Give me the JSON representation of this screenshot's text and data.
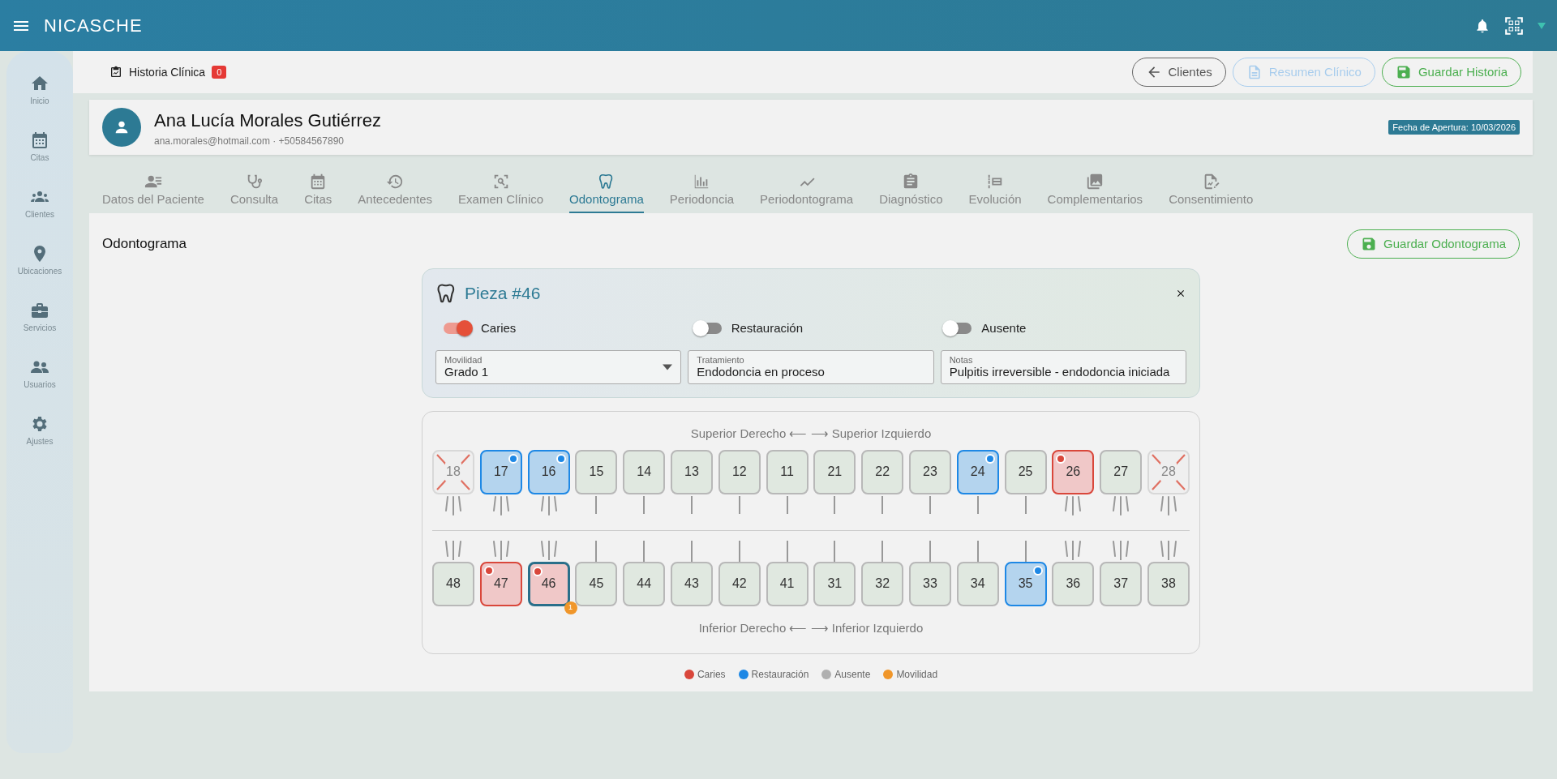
{
  "app_bar": {
    "title": "NICASCHE"
  },
  "sidebar": {
    "items": [
      {
        "label": "Inicio"
      },
      {
        "label": "Citas"
      },
      {
        "label": "Clientes"
      },
      {
        "label": "Ubicaciones"
      },
      {
        "label": "Servicios"
      },
      {
        "label": "Usuarios"
      },
      {
        "label": "Ajustes"
      }
    ]
  },
  "toolbar": {
    "title": "Historia Clínica",
    "badge": "0",
    "buttons": [
      {
        "label": "Clientes",
        "kind": "back",
        "disabled": false
      },
      {
        "label": "Resumen Clínico",
        "kind": "document",
        "disabled": true
      },
      {
        "label": "Guardar Historia",
        "kind": "save",
        "disabled": false
      }
    ]
  },
  "patient": {
    "name": "Ana Lucía Morales Gutiérrez",
    "contact": "ana.morales@hotmail.com · +50584567890",
    "opening_date": "Fecha de Apertura: 10/03/2026"
  },
  "tabs": [
    {
      "label": "Datos del Paciente",
      "selected": false
    },
    {
      "label": "Consulta",
      "selected": false
    },
    {
      "label": "Citas",
      "selected": false
    },
    {
      "label": "Antecedentes",
      "selected": false
    },
    {
      "label": "Examen Clínico",
      "selected": false
    },
    {
      "label": "Odontograma",
      "selected": true
    },
    {
      "label": "Periodoncia",
      "selected": false
    },
    {
      "label": "Periodontograma",
      "selected": false
    },
    {
      "label": "Diagnóstico",
      "selected": false
    },
    {
      "label": "Evolución",
      "selected": false
    },
    {
      "label": "Complementarios",
      "selected": false
    },
    {
      "label": "Consentimiento",
      "selected": false
    }
  ],
  "section": {
    "title": "Odontograma",
    "save_button": "Guardar Odontograma"
  },
  "piece_editor": {
    "title": "Pieza #46",
    "toggles": [
      {
        "label": "Caries",
        "on": true
      },
      {
        "label": "Restauración",
        "on": false
      },
      {
        "label": "Ausente",
        "on": false
      }
    ],
    "fields": [
      {
        "label": "Movilidad",
        "value": "Grado 1",
        "kind": "select"
      },
      {
        "label": "Tratamiento",
        "value": "Endodoncia en proceso",
        "kind": "text"
      },
      {
        "label": "Notas",
        "value": "Pulpitis irreversible - endodoncia iniciada",
        "kind": "text"
      }
    ]
  },
  "chart": {
    "upper_caption": "Superior Derecho ⟵ ⟶ Superior Izquierdo",
    "upper": [
      {
        "number": "18",
        "caries": false,
        "restoration": false,
        "absent": true,
        "kind": "molar",
        "selected": false
      },
      {
        "number": "17",
        "caries": false,
        "restoration": true,
        "absent": false,
        "kind": "molar",
        "selected": false
      },
      {
        "number": "16",
        "caries": false,
        "restoration": true,
        "absent": false,
        "kind": "molar",
        "selected": false
      },
      {
        "number": "15",
        "caries": false,
        "restoration": false,
        "absent": false,
        "kind": "single",
        "selected": false
      },
      {
        "number": "14",
        "caries": false,
        "restoration": false,
        "absent": false,
        "kind": "single",
        "selected": false
      },
      {
        "number": "13",
        "caries": false,
        "restoration": false,
        "absent": false,
        "kind": "single",
        "selected": false
      },
      {
        "number": "12",
        "caries": false,
        "restoration": false,
        "absent": false,
        "kind": "single",
        "selected": false
      },
      {
        "number": "11",
        "caries": false,
        "restoration": false,
        "absent": false,
        "kind": "single",
        "selected": false
      },
      {
        "number": "21",
        "caries": false,
        "restoration": false,
        "absent": false,
        "kind": "single",
        "selected": false
      },
      {
        "number": "22",
        "caries": false,
        "restoration": false,
        "absent": false,
        "kind": "single",
        "selected": false
      },
      {
        "number": "23",
        "caries": false,
        "restoration": false,
        "absent": false,
        "kind": "single",
        "selected": false
      },
      {
        "number": "24",
        "caries": false,
        "restoration": true,
        "absent": false,
        "kind": "single",
        "selected": false
      },
      {
        "number": "25",
        "caries": false,
        "restoration": false,
        "absent": false,
        "kind": "single",
        "selected": false
      },
      {
        "number": "26",
        "caries": true,
        "restoration": false,
        "absent": false,
        "kind": "molar",
        "selected": false
      },
      {
        "number": "27",
        "caries": false,
        "restoration": false,
        "absent": false,
        "kind": "molar",
        "selected": false
      },
      {
        "number": "28",
        "caries": false,
        "restoration": false,
        "absent": true,
        "kind": "molar",
        "selected": false
      }
    ],
    "lower": [
      {
        "number": "48",
        "caries": false,
        "restoration": false,
        "absent": false,
        "kind": "molar",
        "selected": false
      },
      {
        "number": "47",
        "caries": true,
        "restoration": false,
        "absent": false,
        "kind": "molar",
        "selected": false
      },
      {
        "number": "46",
        "caries": true,
        "restoration": false,
        "absent": false,
        "kind": "molar",
        "selected": true,
        "mobility": "1"
      },
      {
        "number": "45",
        "caries": false,
        "restoration": false,
        "absent": false,
        "kind": "single",
        "selected": false
      },
      {
        "number": "44",
        "caries": false,
        "restoration": false,
        "absent": false,
        "kind": "single",
        "selected": false
      },
      {
        "number": "43",
        "caries": false,
        "restoration": false,
        "absent": false,
        "kind": "single",
        "selected": false
      },
      {
        "number": "42",
        "caries": false,
        "restoration": false,
        "absent": false,
        "kind": "single",
        "selected": false
      },
      {
        "number": "41",
        "caries": false,
        "restoration": false,
        "absent": false,
        "kind": "single",
        "selected": false
      },
      {
        "number": "31",
        "caries": false,
        "restoration": false,
        "absent": false,
        "kind": "single",
        "selected": false
      },
      {
        "number": "32",
        "caries": false,
        "restoration": false,
        "absent": false,
        "kind": "single",
        "selected": false
      },
      {
        "number": "33",
        "caries": false,
        "restoration": false,
        "absent": false,
        "kind": "single",
        "selected": false
      },
      {
        "number": "34",
        "caries": false,
        "restoration": false,
        "absent": false,
        "kind": "single",
        "selected": false
      },
      {
        "number": "35",
        "caries": false,
        "restoration": true,
        "absent": false,
        "kind": "single",
        "selected": false
      },
      {
        "number": "36",
        "caries": false,
        "restoration": false,
        "absent": false,
        "kind": "molar",
        "selected": false
      },
      {
        "number": "37",
        "caries": false,
        "restoration": false,
        "absent": false,
        "kind": "molar",
        "selected": false
      },
      {
        "number": "38",
        "caries": false,
        "restoration": false,
        "absent": false,
        "kind": "molar",
        "selected": false
      }
    ],
    "lower_caption": "Inferior Derecho ⟵ ⟶ Inferior Izquierdo"
  },
  "legend": [
    {
      "label": "Caries",
      "color": "#d9473b"
    },
    {
      "label": "Restauración",
      "color": "#1e88e5"
    },
    {
      "label": "Ausente",
      "color": "#b0b0b0"
    },
    {
      "label": "Movilidad",
      "color": "#f0962a"
    }
  ]
}
